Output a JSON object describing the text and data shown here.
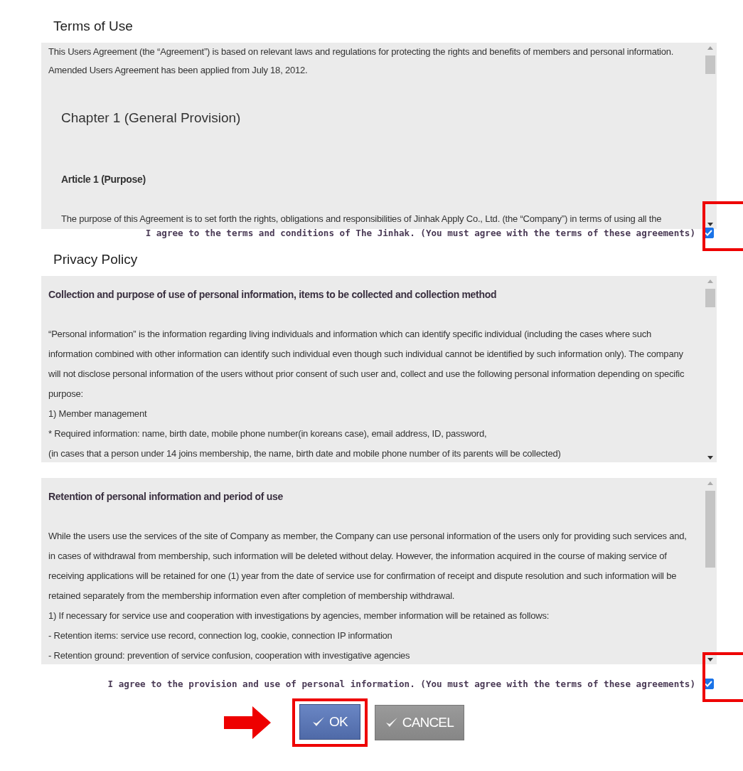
{
  "sections": [
    {
      "title": "Terms of Use",
      "panes": [
        {
          "paragraphs": [
            {
              "kind": "body",
              "text": "This Users Agreement (the “Agreement”) is based on relevant laws and regulations for protecting the rights and benefits of members and personal information."
            },
            {
              "kind": "body",
              "text": "Amended Users Agreement has been applied from July 18, 2012."
            },
            {
              "kind": "chapter",
              "text": "Chapter 1 (General Provision)"
            },
            {
              "kind": "article",
              "text": "Article 1 (Purpose)"
            },
            {
              "kind": "article-body",
              "text": "The purpose of this Agreement is to set forth the rights, obligations and responsibilities of Jinhak Apply Co., Ltd. (the “Company”) in terms of using all the"
            }
          ]
        }
      ],
      "agreement": {
        "label": "I agree to the terms and conditions of The Jinhak. (You must agree with the terms of these agreements)",
        "checked": true,
        "highlighted": true
      }
    },
    {
      "title": "Privacy Policy",
      "panes": [
        {
          "paragraphs": [
            {
              "kind": "heading",
              "text": "Collection and purpose of use of personal information, items to be collected and collection method"
            },
            {
              "kind": "body",
              "text": "“Personal information” is the information regarding living individuals and information which can identify specific individual (including the cases where such information combined with other information can identify such individual even though such individual cannot be identified by such information only). The company will not disclose personal information of the users without prior consent of such user and, collect and use the following personal information depending on specific purpose:"
            },
            {
              "kind": "body",
              "text": "1) Member management"
            },
            {
              "kind": "body",
              "text": "* Required information: name, birth date, mobile phone number(in koreans case), email address, ID, password,"
            },
            {
              "kind": "body",
              "text": "(in cases that a person under 14 joins membership, the name, birth date and mobile phone number of its parents will be collected)"
            }
          ]
        },
        {
          "paragraphs": [
            {
              "kind": "heading",
              "text": "Retention of personal information and period of use"
            },
            {
              "kind": "body",
              "text": "While the users use the services of the site of Company as member, the Company can use personal information of the users only for providing such services and, in cases of withdrawal from membership, such information will be deleted without delay. However, the information acquired in the course of making service of receiving applications will be retained for one (1) year from the date of service use for confirmation of receipt and dispute resolution and such information will be retained separately from the membership information even after completion of membership withdrawal."
            },
            {
              "kind": "body",
              "text": "1) If necessary for service use and cooperation with investigations by agencies, member information will be retained as follows:"
            },
            {
              "kind": "body",
              "text": "- Retention items: service use record, connection log, cookie, connection IP information"
            },
            {
              "kind": "body",
              "text": "- Retention ground: prevention of service confusion, cooperation with investigative agencies"
            }
          ]
        }
      ],
      "agreement": {
        "label": "I agree to the provision and use of personal information. (You must agree with the terms of these agreements)",
        "checked": true,
        "highlighted": true
      }
    }
  ],
  "buttons": [
    {
      "label": "OK",
      "kind": "primary",
      "highlighted": true
    },
    {
      "label": "CANCEL",
      "kind": "secondary",
      "highlighted": false
    }
  ]
}
